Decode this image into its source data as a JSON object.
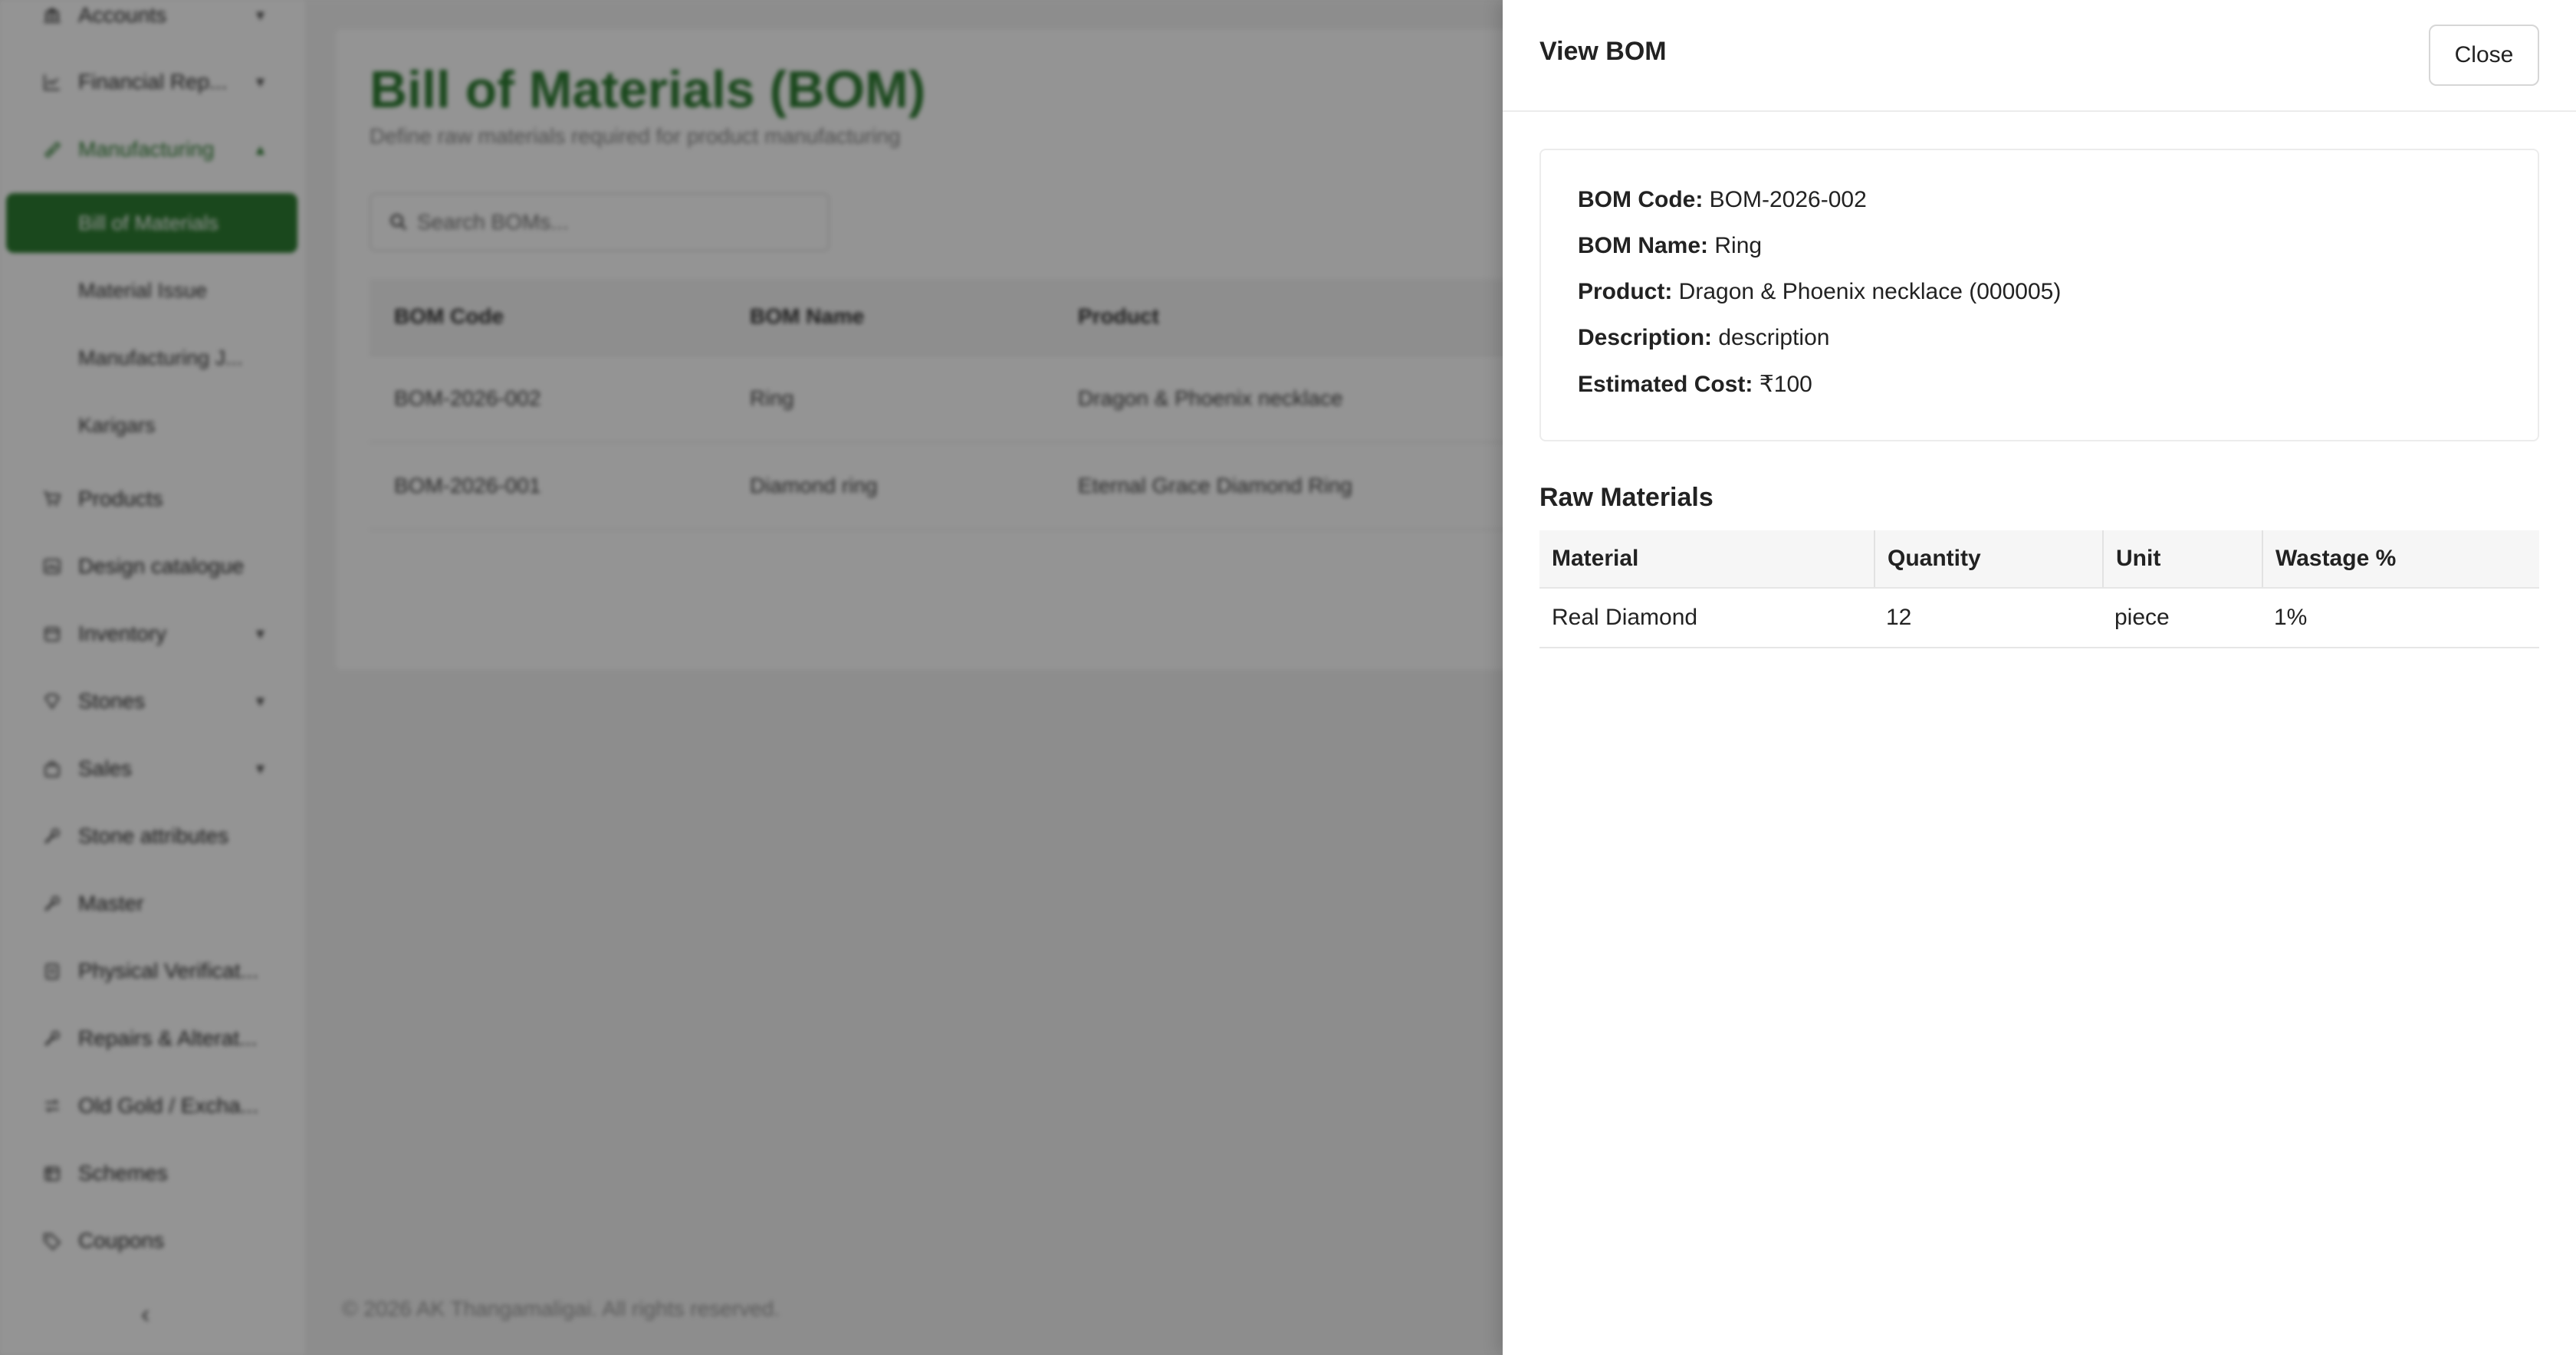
{
  "sidebar": {
    "items": [
      {
        "label": "Accounts",
        "icon": "bank-icon",
        "chevron": "▾"
      },
      {
        "label": "Financial Rep...",
        "icon": "chart-icon",
        "chevron": "▾"
      },
      {
        "label": "Manufacturing",
        "icon": "flask-icon",
        "chevron": "▴"
      },
      {
        "label": "Products",
        "icon": "cart-icon"
      },
      {
        "label": "Design catalogue",
        "icon": "image-icon"
      },
      {
        "label": "Inventory",
        "icon": "box-icon",
        "chevron": "▾"
      },
      {
        "label": "Stones",
        "icon": "gem-icon",
        "chevron": "▾"
      },
      {
        "label": "Sales",
        "icon": "bag-icon",
        "chevron": "▾"
      },
      {
        "label": "Stone attributes",
        "icon": "wrench-icon"
      },
      {
        "label": "Master",
        "icon": "wrench-icon"
      },
      {
        "label": "Physical Verificat...",
        "icon": "clipboard-icon"
      },
      {
        "label": "Repairs & Alterat...",
        "icon": "wrench-icon"
      },
      {
        "label": "Old Gold / Excha...",
        "icon": "exchange-icon"
      },
      {
        "label": "Schemes",
        "icon": "calendar-icon"
      },
      {
        "label": "Coupons",
        "icon": "tag-icon"
      }
    ],
    "manufacturing_sub": [
      {
        "label": "Bill of Materials",
        "active": true
      },
      {
        "label": "Material Issue"
      },
      {
        "label": "Manufacturing J..."
      },
      {
        "label": "Karigars"
      }
    ],
    "collapse_glyph": "‹"
  },
  "page": {
    "title": "Bill of Materials (BOM)",
    "subtitle": "Define raw materials required for product manufacturing",
    "search_placeholder": "Search BOMs...",
    "table": {
      "headers": [
        "BOM Code",
        "BOM Name",
        "Product"
      ],
      "rows": [
        [
          "BOM-2026-002",
          "Ring",
          "Dragon & Phoenix necklace"
        ],
        [
          "BOM-2026-001",
          "Diamond ring",
          "Eternal Grace Diamond Ring"
        ]
      ]
    },
    "footer": "© 2026 AK Thangamaligai. All rights reserved."
  },
  "drawer": {
    "title": "View BOM",
    "close_label": "Close",
    "details": {
      "bom_code_label": "BOM Code:",
      "bom_code": "BOM-2026-002",
      "bom_name_label": "BOM Name:",
      "bom_name": "Ring",
      "product_label": "Product:",
      "product": "Dragon & Phoenix necklace (000005)",
      "description_label": "Description:",
      "description": "description",
      "estimated_cost_label": "Estimated Cost:",
      "estimated_cost": "₹100"
    },
    "raw_materials": {
      "title": "Raw Materials",
      "headers": [
        "Material",
        "Quantity",
        "Unit",
        "Wastage %"
      ],
      "rows": [
        [
          "Real Diamond",
          "12",
          "piece",
          "1%"
        ]
      ]
    }
  },
  "colors": {
    "brand_green": "#2e7d32",
    "overlay": "rgba(0,0,0,0.42)"
  }
}
